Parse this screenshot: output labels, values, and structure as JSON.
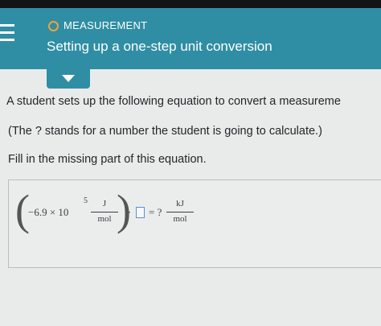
{
  "header": {
    "topic": "MEASUREMENT",
    "title": "Setting up a one-step unit conversion",
    "accent_color": "#2f8ea3",
    "status_color": "#f0a23a",
    "menu_icon": "hamburger-menu-icon",
    "collapse_icon": "chevron-down-icon"
  },
  "question": {
    "line1": "A student sets up the following equation to convert a measureme",
    "line2": "(The ? stands for a number the student is going to calculate.)",
    "line3": "Fill in the missing part of this equation."
  },
  "equation": {
    "coefficient": "−6.9 × 10",
    "exponent": "5",
    "unit1_num": "J",
    "unit1_den": "mol",
    "operator": "·",
    "equals": "= ?",
    "unit2_num": "kJ",
    "unit2_den": "mol"
  }
}
